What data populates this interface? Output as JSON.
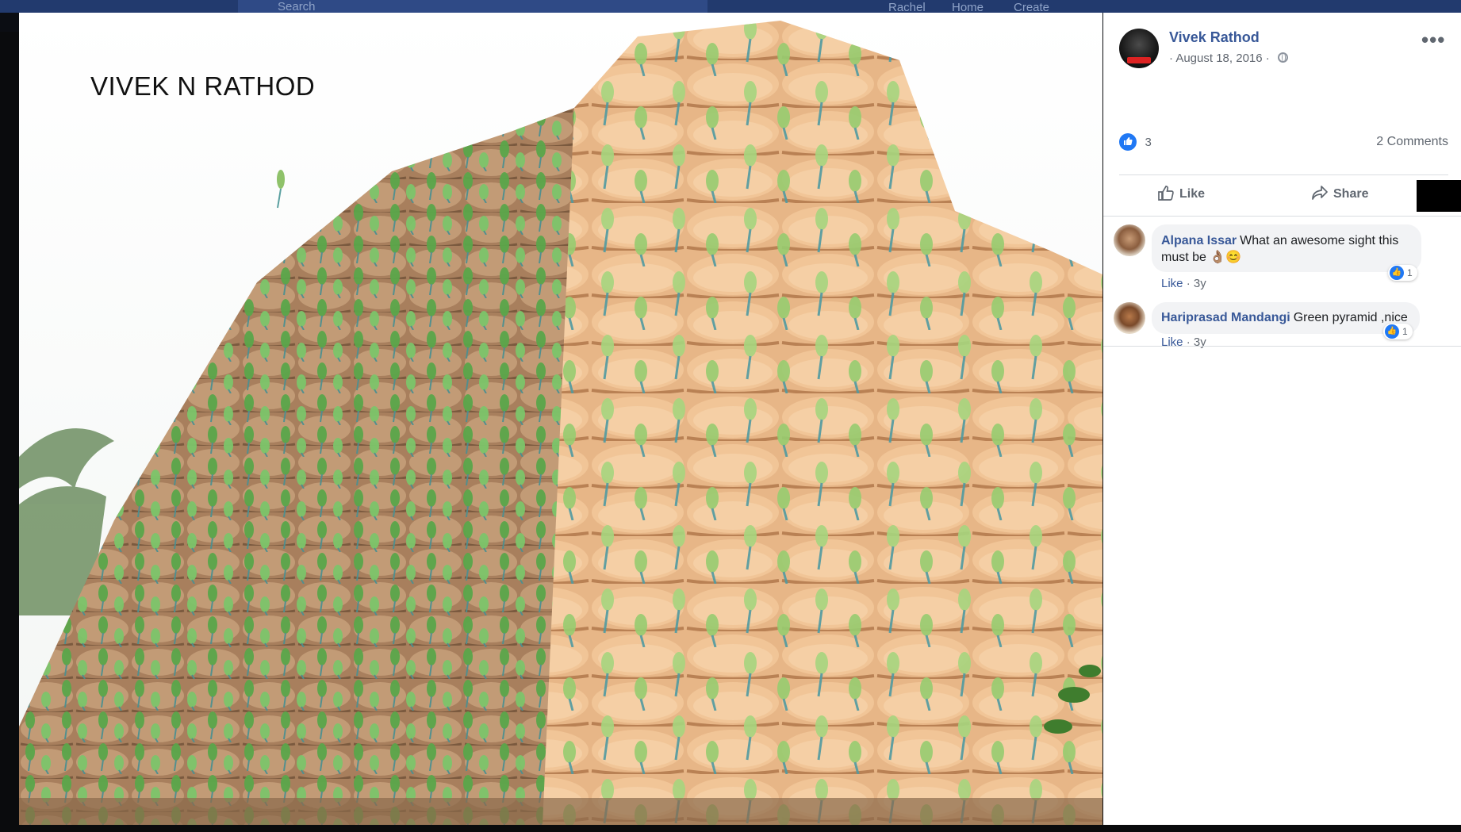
{
  "nav": {
    "search_placeholder": "Search",
    "items": [
      "Rachel",
      "Home",
      "Create"
    ]
  },
  "photo": {
    "watermark_text": "VIVEK N RATHOD"
  },
  "post": {
    "author": "Vivek Rathod",
    "date": "· August 18, 2016 ·",
    "more_label": "•••",
    "reactions_count": "3",
    "comments_count": "2 Comments",
    "like_label": "Like",
    "share_label": "Share"
  },
  "comments": [
    {
      "name": "Alpana Issar",
      "text": "What an awesome sight this must be 👌🏽😊",
      "reactions": "1",
      "like": "Like",
      "age": "· 3y"
    },
    {
      "name": "Hariprasad Mandangi",
      "text": "Green pyramid ,nice",
      "reactions": "1",
      "like": "Like",
      "age": "· 3y"
    }
  ],
  "colors": {
    "link_blue": "#385898",
    "like_blue": "#2078f4",
    "meta_gray": "#606770"
  }
}
